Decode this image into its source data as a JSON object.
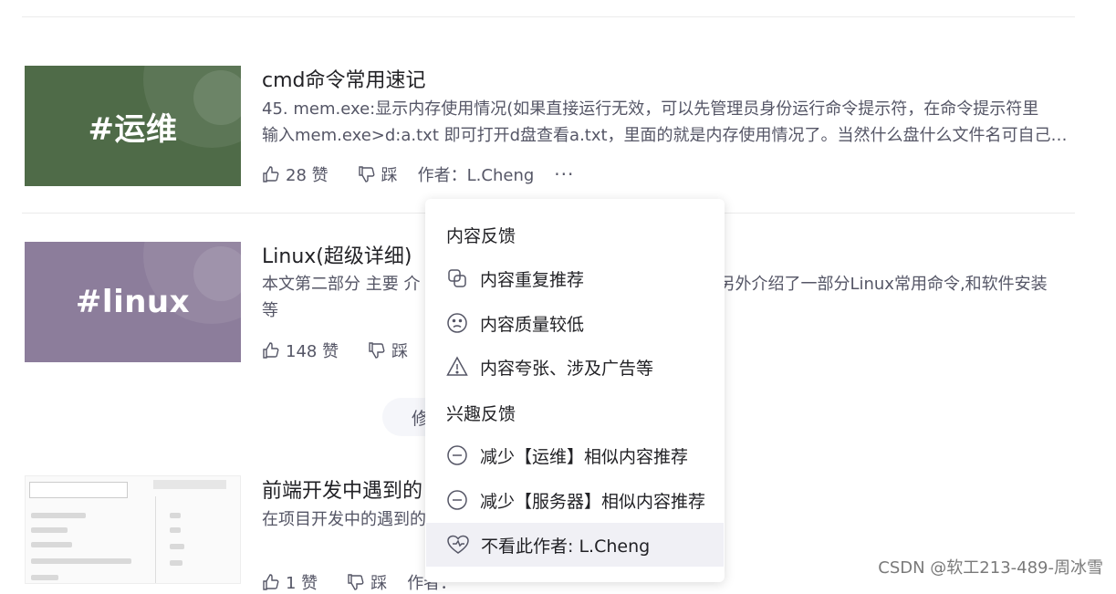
{
  "articles": [
    {
      "thumb_text": "#运维",
      "thumb_color": "#4f6b48",
      "title": "cmd命令常用速记",
      "desc_line1": "45. mem.exe:显示内存使用情况(如果直接运行无效，可以先管理员身份运行命令提示符，在命令提示符里",
      "desc_line2": "输入mem.exe>d:a.txt 即可打开d盘查看a.txt，里面的就是内存使用情况了。当然什么盘什么文件名可自己…",
      "likes": "28 赞",
      "dislike": "踩",
      "author": "作者：L.Cheng",
      "more": "···"
    },
    {
      "thumb_text": "#linux",
      "thumb_color": "#8c7d9b",
      "title": "Linux(超级详细)",
      "desc_line1a": "本文第二部分 主要 介",
      "desc_line1b": "另外介绍了一部分Linux常用命令,和软件安装",
      "desc_line2": "等",
      "likes": "148 赞",
      "dislike": "踩"
    },
    {
      "title": "前端开发中遇到的",
      "desc_line1": "在项目开发中的遇到的",
      "likes": "1 赞",
      "dislike": "踩",
      "author_partial": "作者："
    }
  ],
  "pill_text": "修",
  "menu": {
    "section1": "内容反馈",
    "items1": [
      {
        "label": "内容重复推荐",
        "icon": "duplicate-icon"
      },
      {
        "label": "内容质量较低",
        "icon": "sad-face-icon"
      },
      {
        "label": "内容夸张、涉及广告等",
        "icon": "warning-icon"
      }
    ],
    "section2": "兴趣反馈",
    "items2": [
      {
        "label": "减少【运维】相似内容推荐",
        "icon": "minus-circle-icon"
      },
      {
        "label": "减少【服务器】相似内容推荐",
        "icon": "minus-circle-icon"
      },
      {
        "label": "不看此作者: L.Cheng",
        "icon": "broken-heart-icon"
      }
    ]
  },
  "watermark": "CSDN @软工213-489-周冰雪"
}
